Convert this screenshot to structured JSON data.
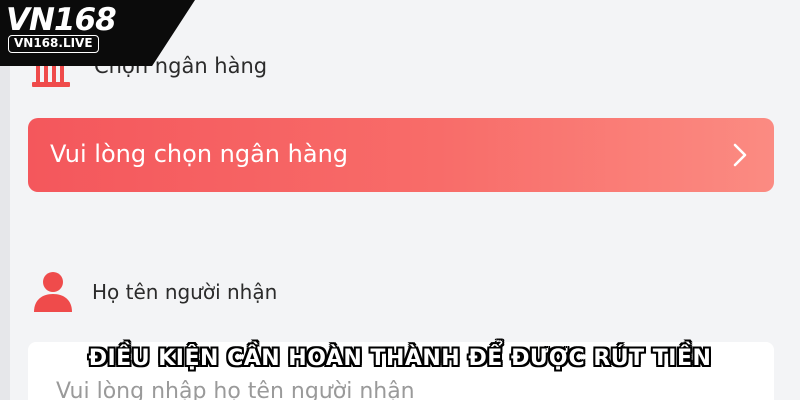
{
  "logo": {
    "main": "VN168",
    "sub": "VN168.LIVE"
  },
  "bank_section": {
    "label": "Chọn ngân hàng",
    "icon": "bank-icon",
    "select_text": "Vui lòng chọn ngân hàng",
    "chevron": "chevron-right-icon"
  },
  "recipient_section": {
    "label": "Họ tên người nhận",
    "icon": "person-icon",
    "placeholder": "Vui lòng nhập họ tên người nhận"
  },
  "caption": "ĐIỀU KIỆN CẦN HOÀN THÀNH ĐỂ ĐƯỢC RÚT TIỀN",
  "colors": {
    "accent_start": "#f4575c",
    "accent_end": "#fb8b82",
    "icon_red": "#ef4b4b",
    "background": "#f3f4f6"
  }
}
